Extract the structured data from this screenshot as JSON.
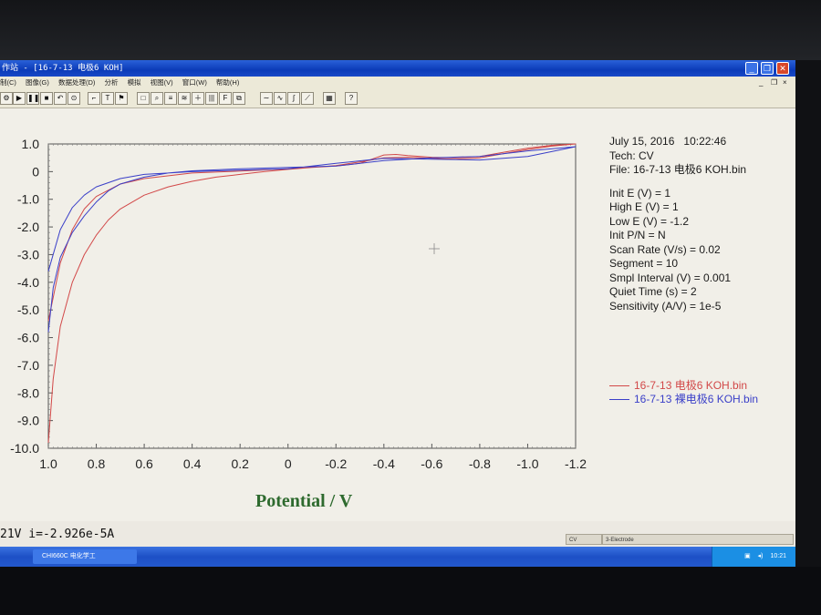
{
  "window": {
    "title": "作站 - [16-7-13 电极6 KOH]"
  },
  "menu": {
    "items": [
      "制(C)",
      "图像(G)",
      "数据处理(D)",
      "分析",
      "模拟",
      "视图(V)",
      "窗口(W)",
      "帮助(H)"
    ],
    "mdi_min": "_",
    "mdi_restore": "❐",
    "mdi_close": "×"
  },
  "info": {
    "date": "July 15, 2016",
    "time": "10:22:46",
    "tech": "Tech: CV",
    "file": "File: 16-7-13 电极6 KOH.bin",
    "params": [
      "Init E (V) = 1",
      "High E (V) = 1",
      "Low E (V) = -1.2",
      "Init P/N = N",
      "Scan Rate (V/s) = 0.02",
      "Segment = 10",
      "Smpl Interval (V) = 0.001",
      "Quiet Time (s) = 2",
      "Sensitivity (A/V) = 1e-5"
    ]
  },
  "status": {
    "readout": "21V   i=-2.926e-5A",
    "panel1": "CV",
    "panel2": "3-Electrode"
  },
  "taskbar": {
    "item": "CHI660C 电化学工",
    "clock": "10:21"
  },
  "colors": {
    "red_series": "#d24848",
    "blue_series": "#3a3fc8"
  },
  "chart_data": {
    "type": "line",
    "xlabel": "Potential / V",
    "ylabel": "",
    "title": "",
    "xlim": [
      1.0,
      -1.2
    ],
    "ylim": [
      -10.0,
      1.0
    ],
    "x_ticks": [
      "1.0",
      "0.8",
      "0.6",
      "0.4",
      "0.2",
      "0",
      "-0.2",
      "-0.4",
      "-0.6",
      "-0.8",
      "-1.0",
      "-1.2"
    ],
    "y_ticks": [
      "1.0",
      "0",
      "-1.0",
      "-2.0",
      "-3.0",
      "-4.0",
      "-5.0",
      "-6.0",
      "-7.0",
      "-8.0",
      "-9.0",
      "-10.0"
    ],
    "grid": false,
    "legend": "right",
    "series": [
      {
        "name": "16-7-13 电极6 KOH.bin",
        "color": "#d24848",
        "x": [
          1.0,
          0.98,
          0.95,
          0.9,
          0.85,
          0.8,
          0.75,
          0.7,
          0.6,
          0.5,
          0.4,
          0.3,
          0.2,
          0.1,
          0.0,
          -0.1,
          -0.2,
          -0.3,
          -0.35,
          -0.4,
          -0.45,
          -0.5,
          -0.6,
          -0.7,
          -0.8,
          -0.9,
          -1.0,
          -1.1,
          -1.2,
          -1.1,
          -1.0,
          -0.9,
          -0.8,
          -0.7,
          -0.6,
          -0.5,
          -0.4,
          -0.3,
          -0.2,
          -0.1,
          0.0,
          0.2,
          0.4,
          0.6,
          0.7,
          0.8,
          0.85,
          0.9,
          0.95,
          1.0
        ],
        "y": [
          -9.8,
          -7.5,
          -5.6,
          -4.0,
          -3.0,
          -2.3,
          -1.75,
          -1.35,
          -0.85,
          -0.55,
          -0.35,
          -0.2,
          -0.1,
          0.0,
          0.08,
          0.15,
          0.2,
          0.3,
          0.45,
          0.6,
          0.62,
          0.58,
          0.52,
          0.5,
          0.55,
          0.7,
          0.85,
          0.95,
          1.0,
          0.92,
          0.8,
          0.65,
          0.5,
          0.45,
          0.48,
          0.52,
          0.5,
          0.35,
          0.22,
          0.15,
          0.1,
          0.02,
          -0.05,
          -0.25,
          -0.45,
          -0.9,
          -1.35,
          -2.1,
          -3.3,
          -5.4
        ]
      },
      {
        "name": "16-7-13 裸电极6 KOH.bin",
        "color": "#3a3fc8",
        "x": [
          1.0,
          0.98,
          0.95,
          0.9,
          0.85,
          0.8,
          0.75,
          0.7,
          0.6,
          0.5,
          0.4,
          0.2,
          0.0,
          -0.2,
          -0.4,
          -0.6,
          -0.8,
          -1.0,
          -1.2,
          -1.0,
          -0.8,
          -0.6,
          -0.4,
          -0.2,
          0.0,
          0.2,
          0.4,
          0.6,
          0.7,
          0.8,
          0.85,
          0.9,
          0.95,
          1.0
        ],
        "y": [
          -5.8,
          -4.2,
          -3.1,
          -2.2,
          -1.6,
          -1.1,
          -0.7,
          -0.45,
          -0.2,
          -0.05,
          0.03,
          0.1,
          0.15,
          0.2,
          0.4,
          0.5,
          0.55,
          0.75,
          0.9,
          0.55,
          0.42,
          0.45,
          0.48,
          0.3,
          0.1,
          0.05,
          0.0,
          -0.1,
          -0.25,
          -0.55,
          -0.85,
          -1.3,
          -2.1,
          -3.6
        ]
      }
    ]
  }
}
